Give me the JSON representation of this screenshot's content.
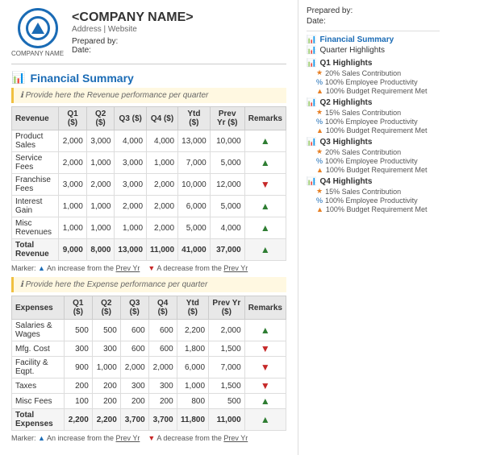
{
  "header": {
    "company_name": "<COMPANY NAME>",
    "address": "Address | Website",
    "logo_text": "COMPANY NAME",
    "prepared_by_label": "Prepared by:",
    "date_label": "Date:"
  },
  "section1": {
    "title": "Financial Summary",
    "info_text": "Provide here the Revenue performance per quarter",
    "table": {
      "columns": [
        "Revenue",
        "Q1 ($)",
        "Q2 ($)",
        "Q3 ($)",
        "Q4 ($)",
        "Ytd ($)",
        "Prev Yr ($)",
        "Remarks"
      ],
      "rows": [
        {
          "label": "Product Sales",
          "q1": "2,000",
          "q2": "3,000",
          "q3": "4,000",
          "q4": "4,000",
          "ytd": "13,000",
          "prev": "10,000",
          "dir": "up"
        },
        {
          "label": "Service Fees",
          "q1": "2,000",
          "q2": "1,000",
          "q3": "3,000",
          "q4": "1,000",
          "ytd": "7,000",
          "prev": "5,000",
          "dir": "up"
        },
        {
          "label": "Franchise Fees",
          "q1": "3,000",
          "q2": "2,000",
          "q3": "3,000",
          "q4": "2,000",
          "ytd": "10,000",
          "prev": "12,000",
          "dir": "down"
        },
        {
          "label": "Interest Gain",
          "q1": "1,000",
          "q2": "1,000",
          "q3": "2,000",
          "q4": "2,000",
          "ytd": "6,000",
          "prev": "5,000",
          "dir": "up"
        },
        {
          "label": "Misc Revenues",
          "q1": "1,000",
          "q2": "1,000",
          "q3": "1,000",
          "q4": "2,000",
          "ytd": "5,000",
          "prev": "4,000",
          "dir": "up"
        },
        {
          "label": "Total Revenue",
          "q1": "9,000",
          "q2": "8,000",
          "q3": "13,000",
          "q4": "11,000",
          "ytd": "41,000",
          "prev": "37,000",
          "dir": "up",
          "total": true
        }
      ]
    },
    "marker": {
      "up_label": "An increase from the",
      "up_link": "Prev Yr",
      "down_label": "A decrease from the",
      "down_link": "Prev Yr"
    }
  },
  "section2": {
    "title": "",
    "info_text": "Provide here the Expense performance per quarter",
    "table": {
      "columns": [
        "Expenses",
        "Q1 ($)",
        "Q2 ($)",
        "Q3 ($)",
        "Q4 ($)",
        "Ytd ($)",
        "Prev Yr ($)",
        "Remarks"
      ],
      "rows": [
        {
          "label": "Salaries & Wages",
          "q1": "500",
          "q2": "500",
          "q3": "600",
          "q4": "600",
          "ytd": "2,200",
          "prev": "2,000",
          "dir": "up"
        },
        {
          "label": "Mfg. Cost",
          "q1": "300",
          "q2": "300",
          "q3": "600",
          "q4": "600",
          "ytd": "1,800",
          "prev": "1,500",
          "dir": "down"
        },
        {
          "label": "Facility & Eqpt.",
          "q1": "900",
          "q2": "1,000",
          "q3": "2,000",
          "q4": "2,000",
          "ytd": "6,000",
          "prev": "7,000",
          "dir": "down"
        },
        {
          "label": "Taxes",
          "q1": "200",
          "q2": "200",
          "q3": "300",
          "q4": "300",
          "ytd": "1,000",
          "prev": "1,500",
          "dir": "down"
        },
        {
          "label": "Misc Fees",
          "q1": "100",
          "q2": "200",
          "q3": "200",
          "q4": "200",
          "ytd": "800",
          "prev": "500",
          "dir": "up"
        },
        {
          "label": "Total Expenses",
          "q1": "2,200",
          "q2": "2,200",
          "q3": "3,700",
          "q4": "3,700",
          "ytd": "11,800",
          "prev": "11,000",
          "dir": "up",
          "total": true
        }
      ]
    }
  },
  "sidebar": {
    "prepared_by": "Prepared by:",
    "date": "Date:",
    "nav": [
      {
        "label": "Financial Summary",
        "active": true,
        "icon": "chart"
      },
      {
        "label": "Quarter Highlights",
        "active": false,
        "icon": "chart-orange"
      }
    ],
    "quarters": [
      {
        "title": "Q1 Highlights",
        "items": [
          {
            "icon": "star",
            "text": "20% Sales Contribution"
          },
          {
            "icon": "pct",
            "text": "100% Employee Productivity"
          },
          {
            "icon": "tri",
            "text": "100% Budget Requirement Met"
          }
        ]
      },
      {
        "title": "Q2 Highlights",
        "items": [
          {
            "icon": "star",
            "text": "15% Sales Contribution"
          },
          {
            "icon": "pct",
            "text": "100% Employee Productivity"
          },
          {
            "icon": "tri",
            "text": "100% Budget Requirement Met"
          }
        ]
      },
      {
        "title": "Q3 Highlights",
        "items": [
          {
            "icon": "star",
            "text": "20% Sales Contribution"
          },
          {
            "icon": "pct",
            "text": "100% Employee Productivity"
          },
          {
            "icon": "tri",
            "text": "100% Budget Requirement Met"
          }
        ]
      },
      {
        "title": "Q4 Highlights",
        "items": [
          {
            "icon": "star",
            "text": "15% Sales Contribution"
          },
          {
            "icon": "pct",
            "text": "100% Employee Productivity"
          },
          {
            "icon": "tri",
            "text": "100% Budget Requirement Met"
          }
        ]
      }
    ]
  }
}
